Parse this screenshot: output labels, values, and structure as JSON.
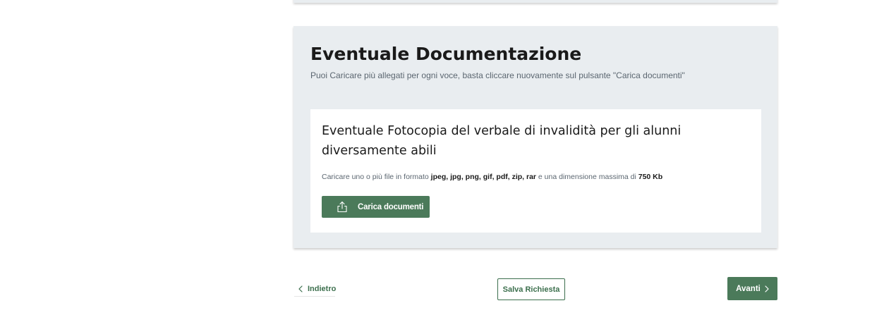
{
  "section": {
    "title": "Eventuale Documentazione",
    "subtitle": "Puoi Caricare più allegati per ogni voce, basta cliccare nuovamente sul pulsante \"Carica documenti\""
  },
  "attachment": {
    "title": "Eventuale Fotocopia del verbale di invalidità per gli alunni diversamente abili",
    "desc_prefix": "Caricare uno o più file in formato ",
    "formats": "jpeg, jpg, png, gif, pdf, zip, rar",
    "desc_middle": " e una dimensione massima di ",
    "max_size": "750 Kb",
    "upload_label": "Carica documenti",
    "upload_icon": "upload-icon"
  },
  "navigation": {
    "back_label": "Indietro",
    "back_icon": "chevron-left-icon",
    "save_label": "Salva Richiesta",
    "next_label": "Avanti",
    "next_icon": "chevron-right-icon"
  },
  "colors": {
    "primary": "#4b7a5a",
    "card_background": "#e9edf0",
    "muted_text": "#5b6670"
  }
}
